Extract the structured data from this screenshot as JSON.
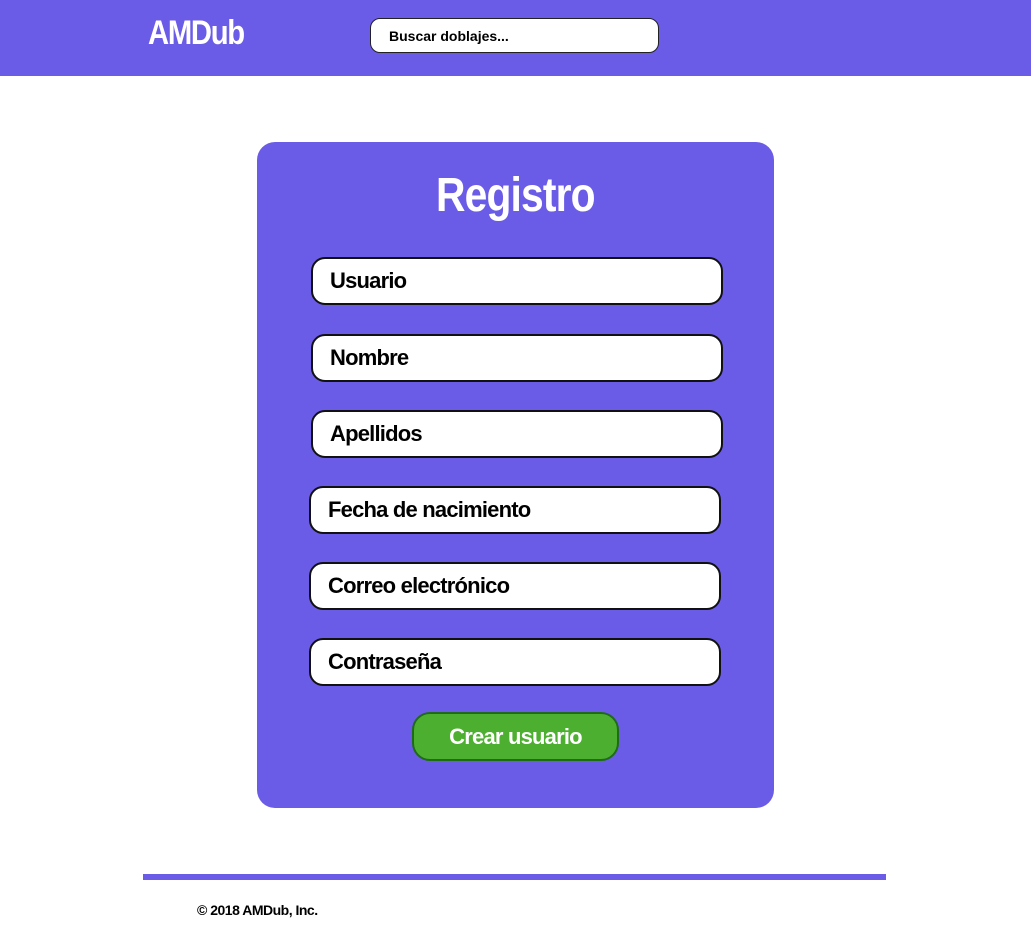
{
  "header": {
    "logo": "AMDub",
    "search_placeholder": "Buscar doblajes..."
  },
  "form": {
    "title": "Registro",
    "fields": [
      {
        "placeholder": "Usuario"
      },
      {
        "placeholder": "Nombre"
      },
      {
        "placeholder": "Apellidos"
      },
      {
        "placeholder": "Fecha de nacimiento"
      },
      {
        "placeholder": "Correo electrónico"
      },
      {
        "placeholder": "Contraseña"
      }
    ],
    "submit_label": "Crear usuario"
  },
  "footer": {
    "copyright": "© 2018 AMDub, Inc."
  },
  "colors": {
    "brand": "#6b5ce7",
    "submit": "#4caf2f"
  }
}
